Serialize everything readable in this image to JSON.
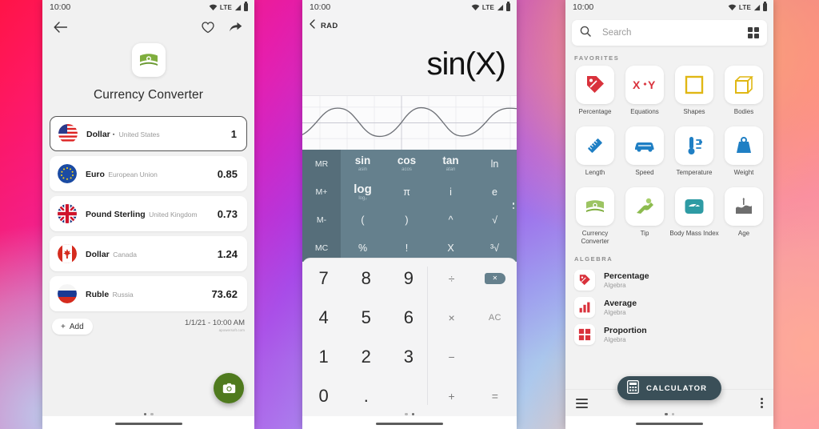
{
  "statusbar": {
    "time": "10:00",
    "network": "LTE"
  },
  "currency_screen": {
    "back_icon": "back-arrow-icon",
    "favorite_icon": "heart-icon",
    "share_icon": "share-icon",
    "app_icon": "money-bill-icon",
    "title": "Currency Converter",
    "rows": [
      {
        "flag": "us",
        "name": "Dollar ·",
        "country": "United States",
        "value": "1",
        "selected": true
      },
      {
        "flag": "eu",
        "name": "Euro",
        "country": "European Union",
        "value": "0.85",
        "selected": false
      },
      {
        "flag": "gb",
        "name": "Pound Sterling",
        "country": "United Kingdom",
        "value": "0.73",
        "selected": false
      },
      {
        "flag": "ca",
        "name": "Dollar",
        "country": "Canada",
        "value": "1.24",
        "selected": false
      },
      {
        "flag": "ru",
        "name": "Ruble",
        "country": "Russia",
        "value": "73.62",
        "selected": false
      }
    ],
    "add_label": "Add",
    "timestamp": "1/1/21 - 10:00 AM",
    "watermark": "apowersoft.com",
    "fab_icon": "camera-icon"
  },
  "calculator_screen": {
    "back_icon": "chevron-left-icon",
    "mode": "RAD",
    "expression": "sin(X)",
    "graph": {
      "function": "sin(x)",
      "cycles": 2.6,
      "grid": true
    },
    "sci_keys": [
      {
        "main": "MR",
        "sub": "",
        "memory": true
      },
      {
        "main": "sin",
        "sub": "asin",
        "memory": false
      },
      {
        "main": "cos",
        "sub": "acos",
        "memory": false
      },
      {
        "main": "tan",
        "sub": "atan",
        "memory": false
      },
      {
        "main": "ln",
        "sub": "",
        "memory": false
      },
      {
        "main": "M+",
        "sub": "",
        "memory": true
      },
      {
        "main": "log",
        "sub": "log₂",
        "memory": false
      },
      {
        "main": "π",
        "sub": "",
        "memory": false
      },
      {
        "main": "i",
        "sub": "",
        "memory": false
      },
      {
        "main": "e",
        "sub": "",
        "memory": false
      },
      {
        "main": "M-",
        "sub": "",
        "memory": true
      },
      {
        "main": "(",
        "sub": "",
        "memory": false
      },
      {
        "main": ")",
        "sub": "",
        "memory": false
      },
      {
        "main": "^",
        "sub": "",
        "memory": false
      },
      {
        "main": "√",
        "sub": "",
        "memory": false
      },
      {
        "main": "MC",
        "sub": "",
        "memory": true
      },
      {
        "main": "%",
        "sub": "",
        "memory": false
      },
      {
        "main": "!",
        "sub": "",
        "memory": false
      },
      {
        "main": "X",
        "sub": "",
        "memory": false
      },
      {
        "main": "³√",
        "sub": "",
        "memory": false
      }
    ],
    "numpad": [
      {
        "label": "7",
        "kind": "num"
      },
      {
        "label": "8",
        "kind": "num"
      },
      {
        "label": "9",
        "kind": "num"
      },
      {
        "label": "÷",
        "kind": "op"
      },
      {
        "label": "",
        "kind": "del"
      },
      {
        "label": "4",
        "kind": "num"
      },
      {
        "label": "5",
        "kind": "num"
      },
      {
        "label": "6",
        "kind": "num"
      },
      {
        "label": "×",
        "kind": "op"
      },
      {
        "label": "AC",
        "kind": "ac"
      },
      {
        "label": "1",
        "kind": "num"
      },
      {
        "label": "2",
        "kind": "num"
      },
      {
        "label": "3",
        "kind": "num"
      },
      {
        "label": "−",
        "kind": "op"
      },
      {
        "label": "",
        "kind": "blank"
      },
      {
        "label": "0",
        "kind": "num"
      },
      {
        "label": ".",
        "kind": "num"
      },
      {
        "label": "",
        "kind": "blank"
      },
      {
        "label": "+",
        "kind": "op"
      },
      {
        "label": "=",
        "kind": "op"
      }
    ],
    "delete_glyph": "✕"
  },
  "tools_screen": {
    "search_icon": "search-icon",
    "search_placeholder": "Search",
    "grid_icon": "grid-view-icon",
    "favorites_label": "FAVORITES",
    "favorites": [
      {
        "label": "Percentage",
        "icon": "price-tag-icon",
        "color": "#d9323c"
      },
      {
        "label": "Equations",
        "icon": "x-plus-y-icon",
        "color": "#d9323c"
      },
      {
        "label": "Shapes",
        "icon": "square-outline-icon",
        "color": "#e0b714"
      },
      {
        "label": "Bodies",
        "icon": "cube-icon",
        "color": "#e0b714"
      },
      {
        "label": "Length",
        "icon": "ruler-icon",
        "color": "#1f7fc4"
      },
      {
        "label": "Speed",
        "icon": "car-icon",
        "color": "#1f7fc4"
      },
      {
        "label": "Temperature",
        "icon": "thermometer-icon",
        "color": "#1f7fc4"
      },
      {
        "label": "Weight",
        "icon": "weight-icon",
        "color": "#1f7fc4"
      },
      {
        "label": "Currency Converter",
        "icon": "money-bill-icon",
        "color": "#7fae3e"
      },
      {
        "label": "Tip",
        "icon": "coin-hand-icon",
        "color": "#7fae3e"
      },
      {
        "label": "Body Mass Index",
        "icon": "bathroom-scale-icon",
        "color": "#2e9ba4"
      },
      {
        "label": "Age",
        "icon": "birthday-cake-icon",
        "color": "#6e6e6e"
      }
    ],
    "algebra_label": "ALGEBRA",
    "algebra_items": [
      {
        "name": "Percentage",
        "sub": "Algebra",
        "icon": "price-tag-icon"
      },
      {
        "name": "Average",
        "sub": "Algebra",
        "icon": "bar-chart-icon"
      },
      {
        "name": "Proportion",
        "sub": "Algebra",
        "icon": "four-squares-icon"
      }
    ],
    "fab_label": "CALCULATOR",
    "fab_icon": "calculator-icon",
    "menu_icon": "hamburger-menu-icon",
    "overflow_icon": "kebab-menu-icon"
  }
}
